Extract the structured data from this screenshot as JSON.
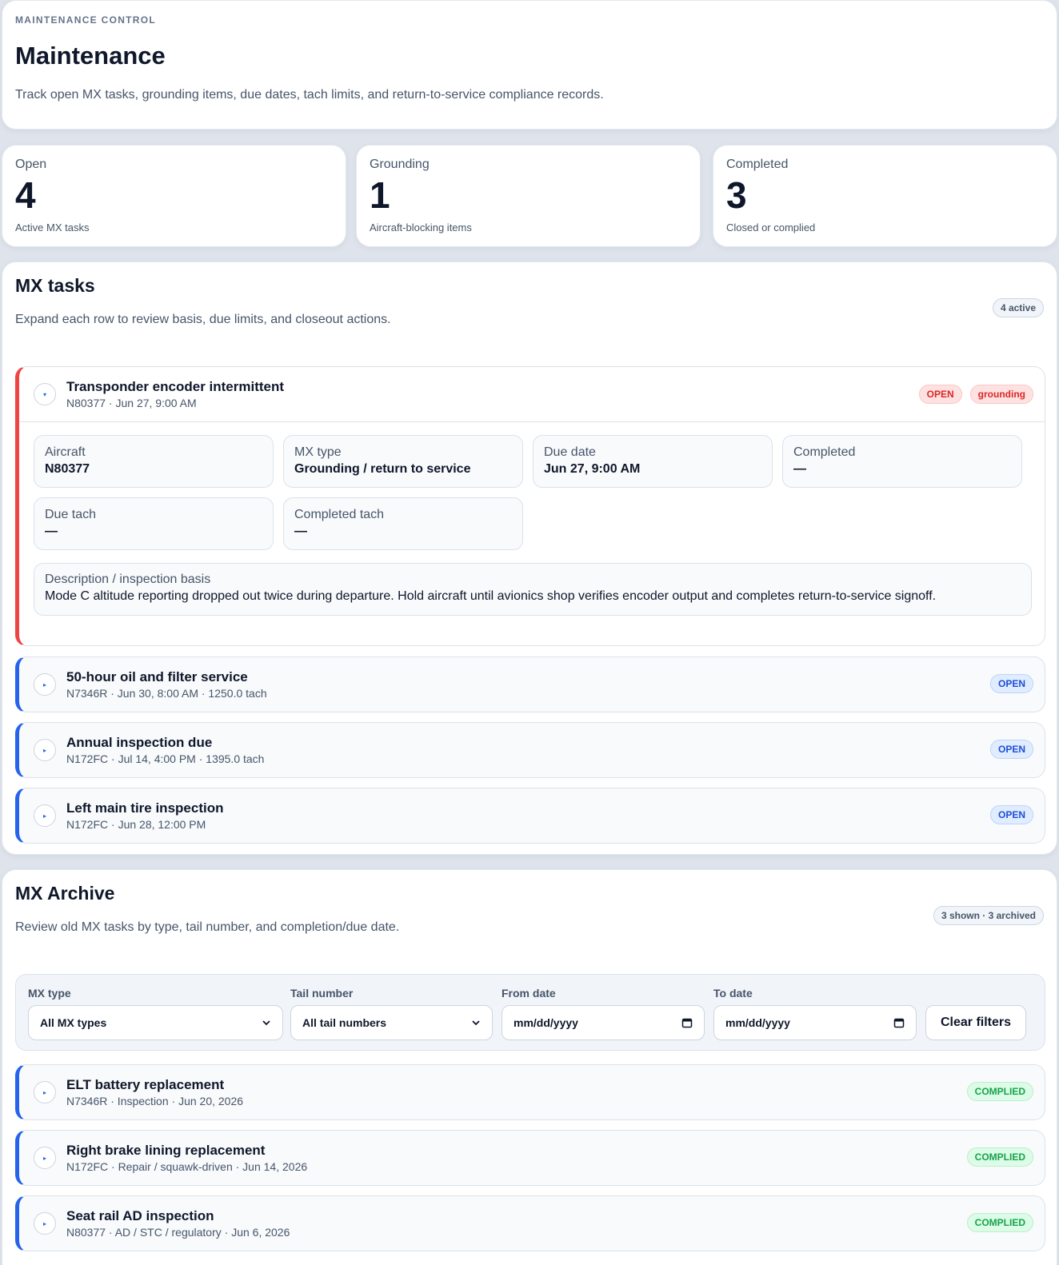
{
  "header": {
    "eyebrow": "MAINTENANCE CONTROL",
    "title": "Maintenance",
    "subtitle": "Track open MX tasks, grounding items, due dates, tach limits, and return-to-service compliance records."
  },
  "stats": [
    {
      "label": "Open",
      "value": "4",
      "caption": "Active MX tasks"
    },
    {
      "label": "Grounding",
      "value": "1",
      "caption": "Aircraft-blocking items"
    },
    {
      "label": "Completed",
      "value": "3",
      "caption": "Closed or complied"
    }
  ],
  "mx_tasks": {
    "title": "MX tasks",
    "subtitle": "Expand each row to review basis, due limits, and closeout actions.",
    "pill": "4 active",
    "expanded": {
      "title": "Transponder encoder intermittent",
      "meta": "N80377 · Jun 27, 9:00 AM",
      "badge_status": "OPEN",
      "badge_grounding": "grounding",
      "toggle_icon": "▾",
      "fields": [
        {
          "label": "Aircraft",
          "value": "N80377"
        },
        {
          "label": "MX type",
          "value": "Grounding / return to service"
        },
        {
          "label": "Due date",
          "value": "Jun 27, 9:00 AM"
        },
        {
          "label": "Completed",
          "value": "—"
        },
        {
          "label": "Due tach",
          "value": "—"
        },
        {
          "label": "Completed tach",
          "value": "—"
        }
      ],
      "description_label": "Description / inspection basis",
      "description": "Mode C altitude reporting dropped out twice during departure. Hold aircraft until avionics shop verifies encoder output and completes return-to-service signoff."
    },
    "rows": [
      {
        "title": "50-hour oil and filter service",
        "meta": "N7346R · Jun 30, 8:00 AM · 1250.0 tach",
        "badge": "OPEN",
        "toggle_icon": "▸"
      },
      {
        "title": "Annual inspection due",
        "meta": "N172FC · Jul 14, 4:00 PM · 1395.0 tach",
        "badge": "OPEN",
        "toggle_icon": "▸"
      },
      {
        "title": "Left main tire inspection",
        "meta": "N172FC · Jun 28, 12:00 PM",
        "badge": "OPEN",
        "toggle_icon": "▸"
      }
    ]
  },
  "archive": {
    "title": "MX Archive",
    "subtitle": "Review old MX tasks by type, tail number, and completion/due date.",
    "pill": "3 shown · 3 archived",
    "filters": {
      "mx_type_label": "MX type",
      "mx_type_value": "All MX types",
      "tail_label": "Tail number",
      "tail_value": "All tail numbers",
      "from_label": "From date",
      "from_placeholder": "mm/dd/yyyy",
      "to_label": "To date",
      "to_placeholder": "mm/dd/yyyy",
      "clear_label": "Clear filters"
    },
    "rows": [
      {
        "title": "ELT battery replacement",
        "meta": "N7346R · Inspection · Jun 20, 2026",
        "badge": "COMPLIED",
        "toggle_icon": "▸"
      },
      {
        "title": "Right brake lining replacement",
        "meta": "N172FC · Repair / squawk-driven · Jun 14, 2026",
        "badge": "COMPLIED",
        "toggle_icon": "▸"
      },
      {
        "title": "Seat rail AD inspection",
        "meta": "N80377 · AD / STC / regulatory · Jun 6, 2026",
        "badge": "COMPLIED",
        "toggle_icon": "▸"
      }
    ]
  }
}
